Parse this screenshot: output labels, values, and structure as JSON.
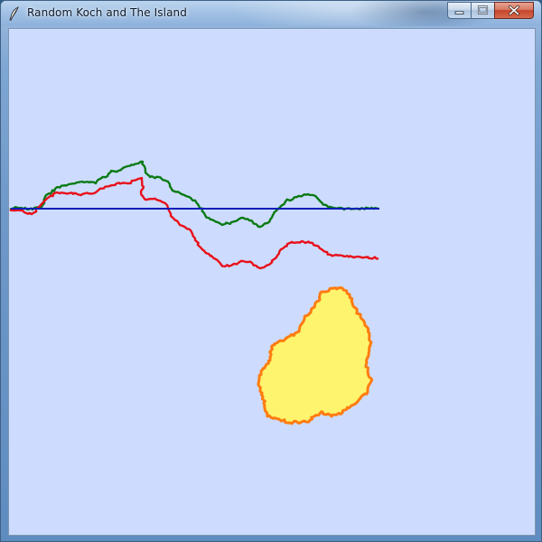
{
  "window": {
    "title": "Random Koch and The Island",
    "icon": "feather-pen-icon"
  },
  "controls": {
    "minimize_icon": "minimize-icon",
    "maximize_icon": "maximize-icon",
    "close_icon": "close-icon"
  },
  "canvas": {
    "background": "#cddcfe",
    "colors": {
      "baseline": "#0a1fb8",
      "green_curve": "#0a7a14",
      "red_curve": "#e8101a",
      "island_fill": "#fff46e",
      "island_stroke": "#ff7c10"
    }
  }
}
